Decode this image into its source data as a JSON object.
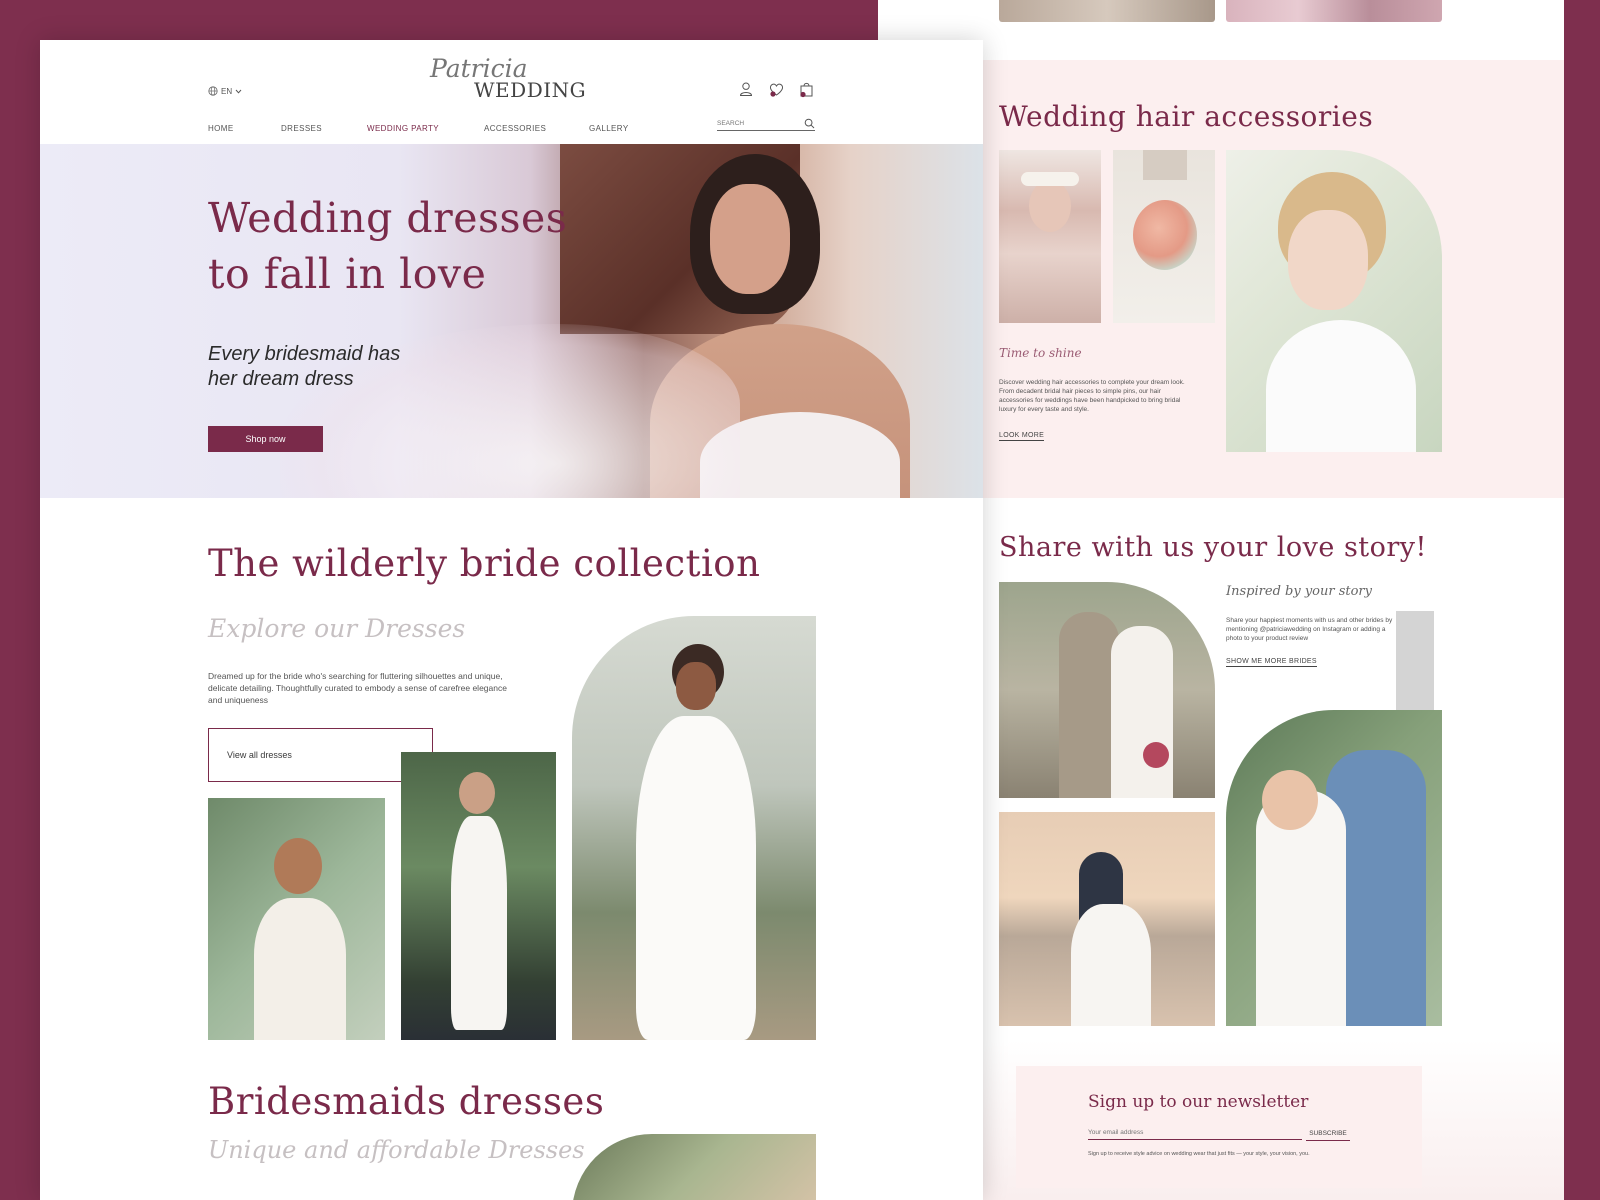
{
  "colors": {
    "brand_maroon": "#7a2a4a",
    "background": "#7e2f4e",
    "blush": "#fcefef"
  },
  "header": {
    "language": "EN",
    "logo_script": "Patricia",
    "logo_main": "WEDDING",
    "nav": [
      "HOME",
      "DRESSES",
      "WEDDING PARTY",
      "ACCESSORIES",
      "GALLERY"
    ],
    "active_nav": "WEDDING PARTY",
    "search_placeholder": "SEARCH",
    "icons": [
      "globe-icon",
      "chevron-down-icon",
      "user-icon",
      "heart-icon",
      "bag-icon",
      "search-icon"
    ]
  },
  "hero": {
    "title_line1": "Wedding dresses",
    "title_line2": "to fall in love",
    "subtitle_line1": "Every bridesmaid has",
    "subtitle_line2": "her dream dress",
    "cta": "Shop now"
  },
  "collection": {
    "title": "The wilderly bride collection",
    "script": "Explore our Dresses",
    "description": "Dreamed up for the bride who's searching for fluttering silhouettes and unique, delicate detailing. Thoughtfully curated to embody a sense of carefree elegance and uniqueness",
    "button": "View all dresses"
  },
  "bridesmaids": {
    "title": "Bridesmaids dresses",
    "script": "Unique and affordable Dresses"
  },
  "hair": {
    "title": "Wedding hair accessories",
    "script": "Time to shine",
    "description": "Discover wedding hair accessories to complete your dream look. From decadent bridal hair pieces to simple pins, our hair accessories for weddings have been handpicked to bring bridal luxury for every taste and style.",
    "link": "LOOK MORE"
  },
  "love": {
    "title": "Share with us your love story!",
    "script": "Inspired by your story",
    "description": "Share your happiest moments with us and other brides by mentioning @patriciawedding on Instagram or adding a photo to your product review",
    "link": "SHOW ME MORE BRIDES"
  },
  "newsletter": {
    "title": "Sign up to our newsletter",
    "placeholder": "Your email address",
    "button": "SUBSCRIBE",
    "note": "Sign up to receive style advice on wedding wear that just fits — your style, your vision, you."
  }
}
